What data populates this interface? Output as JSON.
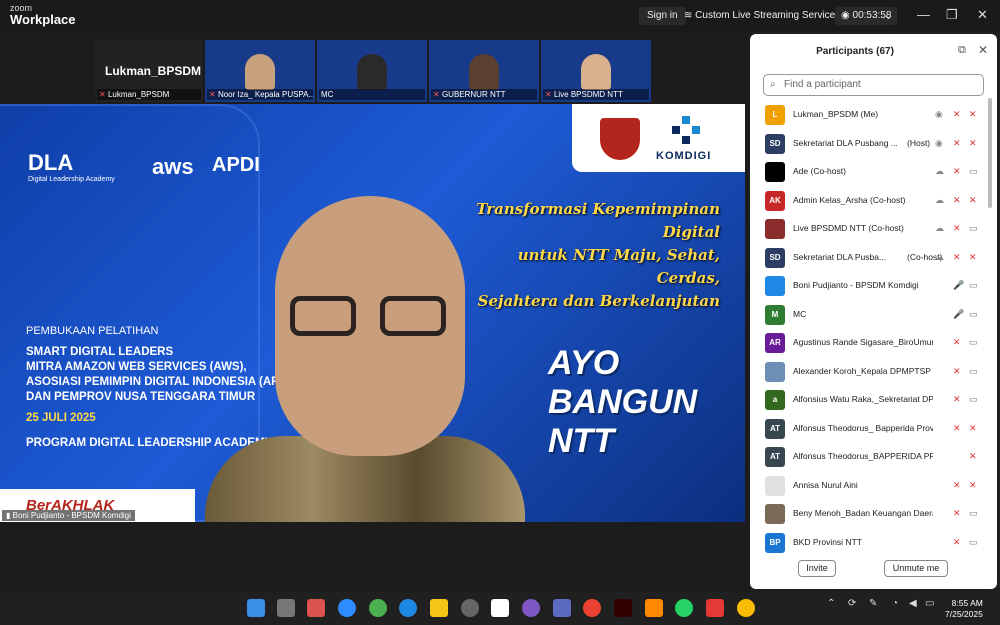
{
  "app": {
    "logo_line1": "zoom",
    "logo_line2": "Workplace"
  },
  "titlebar": {
    "sign_in": "Sign in",
    "stream": "Custom Live Streaming Service",
    "timer": "00:53:58"
  },
  "thumbnails": [
    {
      "big_label": "Lukman_BPSDM",
      "name": "Lukman_BPSDM"
    },
    {
      "name": "Noor Iza_ Kepala PUSPA..."
    },
    {
      "name": "MC"
    },
    {
      "name": "GUBERNUR NTT"
    },
    {
      "name": "Live BPSDMD NTT"
    }
  ],
  "main_video": {
    "dla_big": "DLA",
    "dla_small": "Digital Leadership Academy",
    "aws": "aws",
    "apdi": "APDI",
    "komdigi": "KOMDIGI",
    "transform_line1": "Transformasi Kepemimpinan Digital",
    "transform_line2": "untuk NTT Maju, Sehat, Cerdas,",
    "transform_line3": "Sejahtera dan Berkelanjutan",
    "ayo": "AYO BANGUN NTT",
    "pembukaan": "PEMBUKAAN PELATIHAN",
    "line1": "SMART DIGITAL LEADERS",
    "line2": "MITRA AMAZON WEB SERVICES (AWS),",
    "line3": "ASOSIASI PEMIMPIN DIGITAL INDONESIA (APDI)",
    "line4": "DAN PEMPROV NUSA TENGGARA TIMUR",
    "date": "25 JULI 2025",
    "program": "PROGRAM DIGITAL LEADERSHIP ACADEMY",
    "berakhlak": "BerAKHLAK",
    "speaker_name": "Boni Pudjianto - BPSDM Komdigi"
  },
  "panel": {
    "title": "Participants (67)",
    "search_placeholder": "Find a participant",
    "invite": "Invite",
    "unmute": "Unmute me",
    "participants": [
      {
        "initials": "L",
        "color": "#f0a000",
        "name": "Lukman_BPSDM (Me)",
        "role": ""
      },
      {
        "initials": "SD",
        "color": "#2c3e63",
        "name": "Sekretariat DLA Pusbang ...",
        "role": "(Host)"
      },
      {
        "initials": "",
        "color": "#000000",
        "name": "Ade (Co-host)",
        "role": ""
      },
      {
        "initials": "AK",
        "color": "#c62828",
        "name": "Admin Kelas_Arsha (Co-host)",
        "role": ""
      },
      {
        "initials": "",
        "color": "#8b2d2d",
        "name": "Live BPSDMD NTT (Co-host)",
        "role": ""
      },
      {
        "initials": "SD",
        "color": "#2c3e63",
        "name": "Sekretariat DLA Pusba...",
        "role": "(Co-host)"
      },
      {
        "initials": "",
        "color": "#1e88e5",
        "name": "Boni Pudjianto - BPSDM Komdigi",
        "role": ""
      },
      {
        "initials": "M",
        "color": "#2e7d32",
        "name": "MC",
        "role": ""
      },
      {
        "initials": "AR",
        "color": "#6a1b9a",
        "name": "Agustinus Rande Sigasare_BiroUmum",
        "role": ""
      },
      {
        "initials": "",
        "color": "#6d8fb5",
        "name": "Alexander Koroh_Kepala DPMPTSP",
        "role": ""
      },
      {
        "initials": "a",
        "color": "#33691e",
        "name": "Alfonsius Watu Raka,_Sekretariat DPR...",
        "role": ""
      },
      {
        "initials": "AT",
        "color": "#37474f",
        "name": "Alfonsus Theodorus_ Bapperida Prov ...",
        "role": ""
      },
      {
        "initials": "AT",
        "color": "#37474f",
        "name": "Alfonsus Theodorus_BAPPERIDA PROV N...",
        "role": ""
      },
      {
        "initials": "",
        "color": "#e0e0e0",
        "name": "Annisa Nurul Aini",
        "role": ""
      },
      {
        "initials": "",
        "color": "#7a6a58",
        "name": "Beny Menoh_Badan Keuangan Daera...",
        "role": ""
      },
      {
        "initials": "BP",
        "color": "#1976d2",
        "name": "BKD Provinsi NTT",
        "role": ""
      }
    ]
  },
  "clock": {
    "time": "8:55 AM",
    "date": "7/25/2025"
  }
}
